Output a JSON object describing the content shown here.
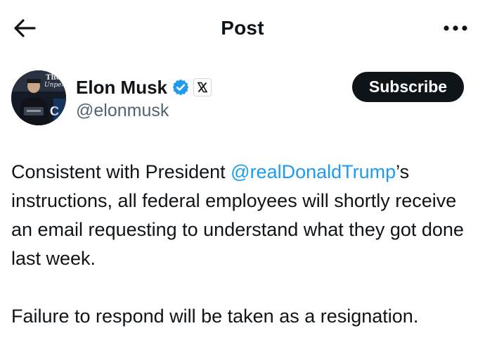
{
  "header": {
    "title": "Post"
  },
  "author": {
    "display_name": "Elon Musk",
    "handle": "@elonmusk",
    "avatar_text": "The Unpera"
  },
  "subscribe": {
    "label": "Subscribe"
  },
  "post": {
    "para1_before": "Consistent with President ",
    "mention": "@realDonaldTrump",
    "para1_after": "’s instructions, all federal employees will shortly receive an email requesting to understand what they got done last week.",
    "para2": "Failure to respond will be taken as a resignation."
  },
  "colors": {
    "text": "#0f1419",
    "secondary": "#536471",
    "link": "#1d9bf0",
    "verified": "#1d9bf0",
    "button_bg": "#0f1419"
  },
  "icons": {
    "back": "arrow-left-icon",
    "more": "more-dots-icon",
    "verified": "verified-badge-icon",
    "affiliate": "x-logo-icon"
  }
}
